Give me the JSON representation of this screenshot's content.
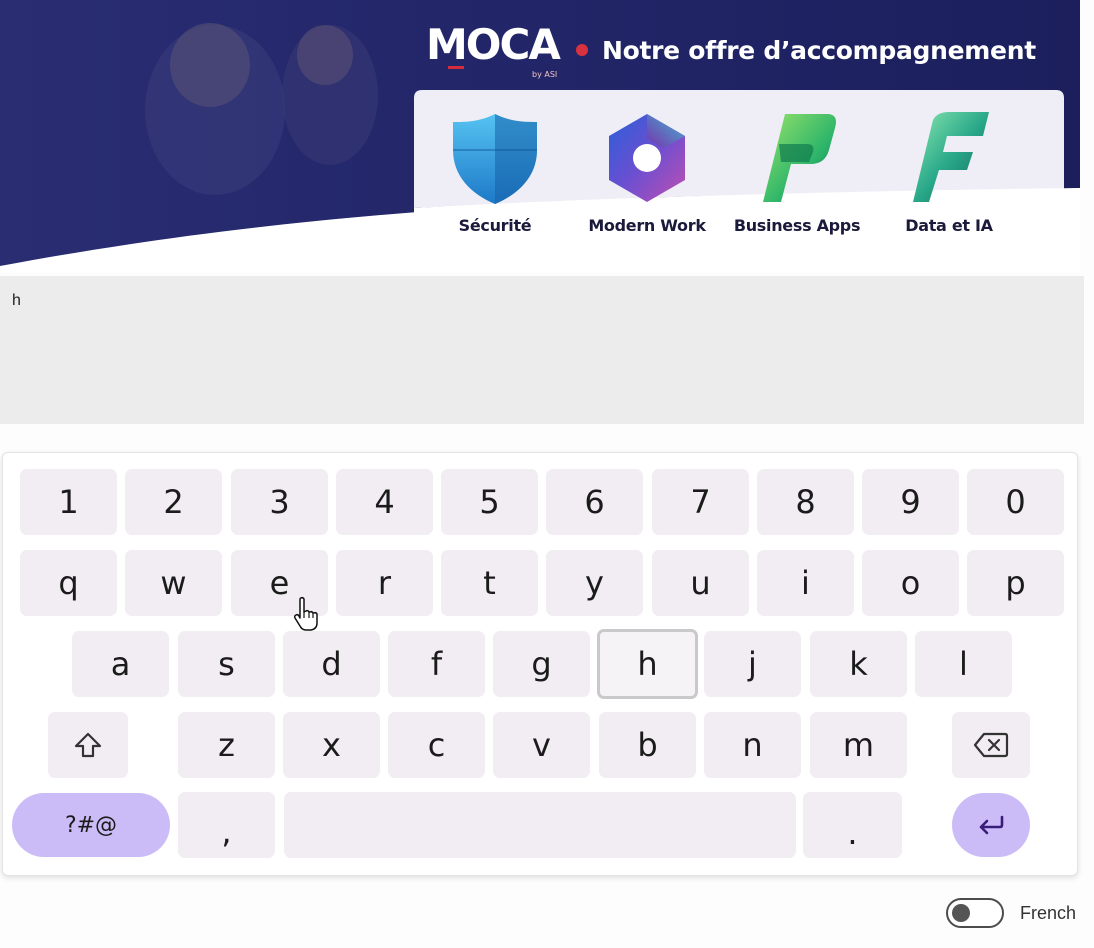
{
  "banner": {
    "logo": "MOCA",
    "logo_by": "by ASI",
    "tagline": "Notre offre d’accompagnement",
    "offers": [
      {
        "label": "Sécurité",
        "icon": "shield-icon"
      },
      {
        "label": "Modern Work",
        "icon": "microsoft365-icon"
      },
      {
        "label": "Business Apps",
        "icon": "power-platform-icon"
      },
      {
        "label": "Data et IA",
        "icon": "fabric-icon"
      }
    ],
    "colors": {
      "navy": "#1e1f5e",
      "red_dot": "#d8313f"
    }
  },
  "input": {
    "value": "h"
  },
  "keyboard": {
    "row_numbers": [
      "1",
      "2",
      "3",
      "4",
      "5",
      "6",
      "7",
      "8",
      "9",
      "0"
    ],
    "row_top": [
      "q",
      "w",
      "e",
      "r",
      "t",
      "y",
      "u",
      "i",
      "o",
      "p"
    ],
    "row_home": [
      "a",
      "s",
      "d",
      "f",
      "g",
      "h",
      "j",
      "k",
      "l"
    ],
    "row_bottom": [
      "z",
      "x",
      "c",
      "v",
      "b",
      "n",
      "m"
    ],
    "shift_icon": "shift-icon",
    "backspace_icon": "backspace-icon",
    "symbols_label": "?#@",
    "comma_label": ",",
    "period_label": ".",
    "enter_icon": "enter-icon",
    "pressed_key": "h",
    "colors": {
      "key_bg": "#f1edf3",
      "accent": "#cbbcf7"
    }
  },
  "language": {
    "label": "French",
    "toggle_on": false
  }
}
